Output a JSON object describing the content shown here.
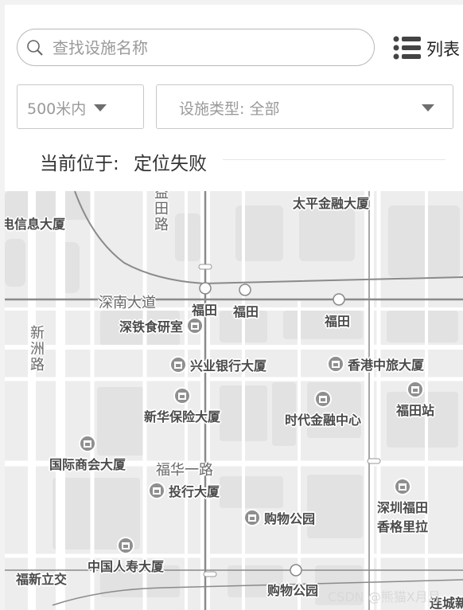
{
  "search": {
    "placeholder": "查找设施名称",
    "icon": "search-icon"
  },
  "view_toggle": {
    "label": "列表",
    "icon": "list-icon"
  },
  "filters": {
    "range": {
      "selected": "500米内",
      "icon": "caret-down-icon"
    },
    "type": {
      "selected": "设施类型: 全部",
      "icon": "caret-down-icon"
    }
  },
  "location": {
    "label": "当前位于:",
    "value": "定位失败"
  },
  "map": {
    "roads": [
      "深南大道",
      "福华一路"
    ],
    "vertical_roads": [
      "新洲路",
      "益田路"
    ],
    "pois": [
      {
        "name": "太平金融大厦"
      },
      {
        "name": "电信息大厦"
      },
      {
        "name": "福田"
      },
      {
        "name": "福田"
      },
      {
        "name": "福田"
      },
      {
        "name": "深铁食研室"
      },
      {
        "name": "兴业银行大厦"
      },
      {
        "name": "香港中旅大厦"
      },
      {
        "name": "福田站"
      },
      {
        "name": "新华保险大厦"
      },
      {
        "name": "时代金融中心"
      },
      {
        "name": "国际商会大厦"
      },
      {
        "name": "投行大厦"
      },
      {
        "name": "深圳福田"
      },
      {
        "name": "香格里拉"
      },
      {
        "name": "购物公园"
      },
      {
        "name": "中国人寿大厦"
      },
      {
        "name": "福新立交"
      },
      {
        "name": "购物公园"
      },
      {
        "name": "连城新"
      }
    ],
    "colors": {
      "background": "#ededed",
      "block": "#e0e0e0",
      "road": "#ffffff",
      "main_road": "#8a8a8a"
    }
  },
  "watermark": "CSDN @熊猫X月月"
}
